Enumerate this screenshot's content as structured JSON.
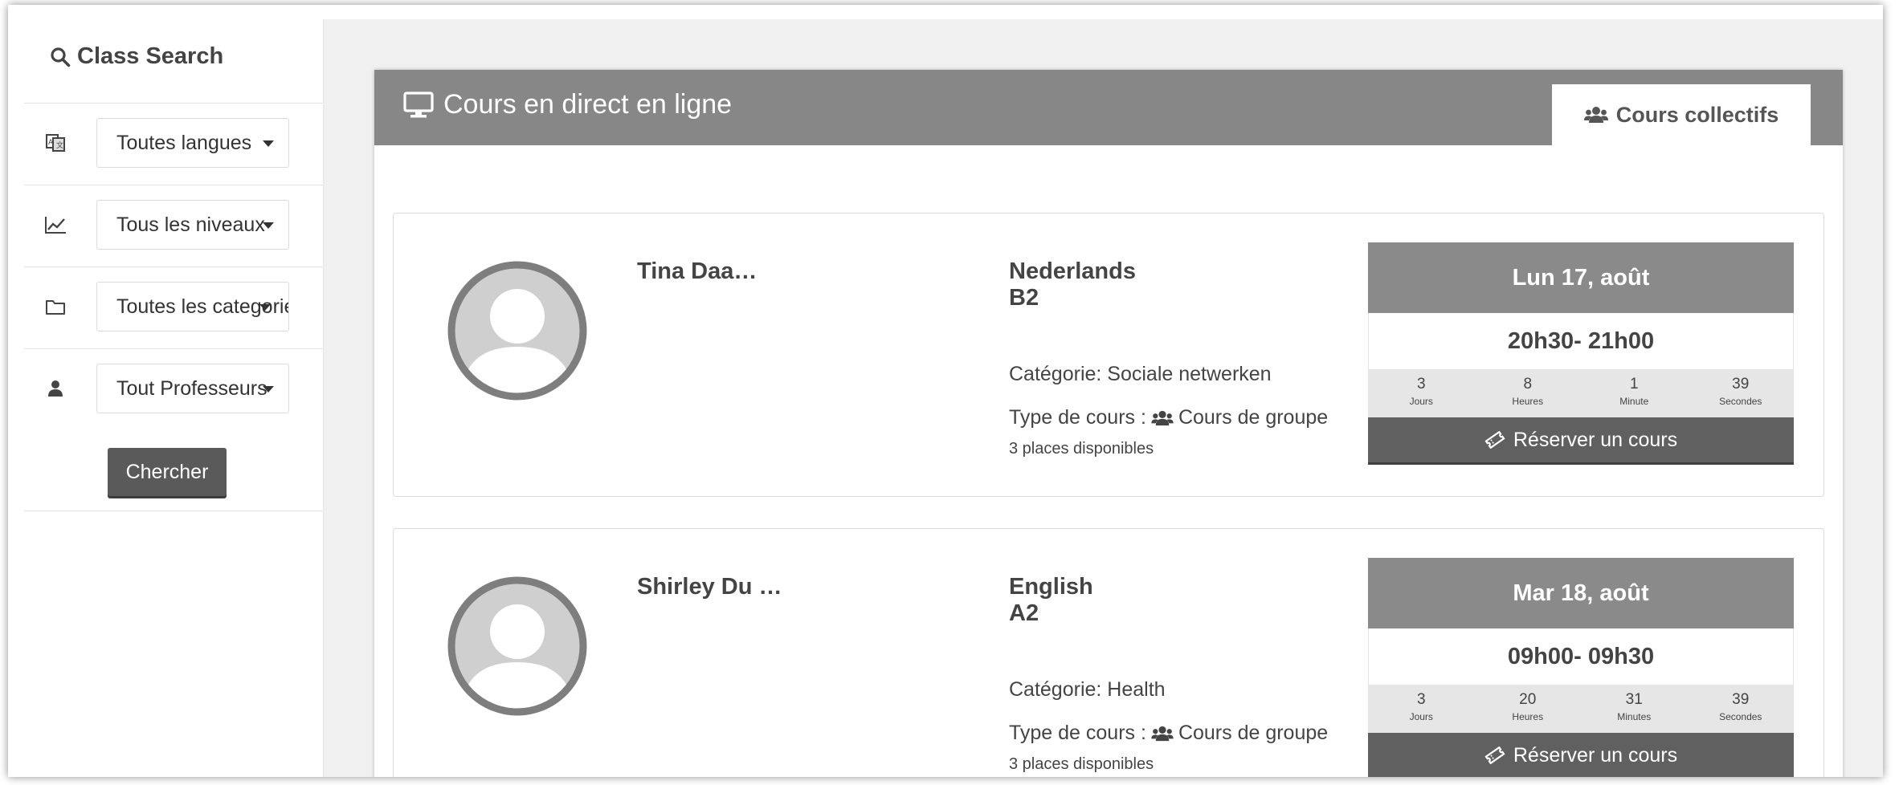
{
  "sidebar": {
    "title": "Class Search",
    "filters": [
      {
        "label": "Toutes langues",
        "icon": "translate-icon"
      },
      {
        "label": "Tous les niveaux",
        "icon": "chart-line-icon"
      },
      {
        "label": "Toutes les categorie",
        "icon": "folder-icon"
      },
      {
        "label": "Tout Professeurs",
        "icon": "user-icon"
      }
    ],
    "search_button": "Chercher"
  },
  "panel": {
    "title": "Cours en direct en ligne",
    "tab_label": "Cours collectifs"
  },
  "courses": [
    {
      "teacher": "Tina Daa…",
      "language": "Nederlands",
      "level": "B2",
      "category": "Catégorie: Sociale netwerken",
      "type_prefix": "Type de cours :",
      "type": "Cours de groupe",
      "places": "3 places disponibles",
      "date": "Lun 17, août",
      "time": "20h30- 21h00",
      "countdown": [
        {
          "value": "3",
          "unit": "Jours"
        },
        {
          "value": "8",
          "unit": "Heures"
        },
        {
          "value": "1",
          "unit": "Minute"
        },
        {
          "value": "39",
          "unit": "Secondes"
        }
      ],
      "book_label": "Réserver un cours"
    },
    {
      "teacher": "Shirley Du …",
      "language": "English",
      "level": "A2",
      "category": "Catégorie: Health",
      "type_prefix": "Type de cours :",
      "type": "Cours de groupe",
      "places": "3 places disponibles",
      "date": "Mar 18, août",
      "time": "09h00- 09h30",
      "countdown": [
        {
          "value": "3",
          "unit": "Jours"
        },
        {
          "value": "20",
          "unit": "Heures"
        },
        {
          "value": "31",
          "unit": "Minutes"
        },
        {
          "value": "39",
          "unit": "Secondes"
        }
      ],
      "book_label": "Réserver un cours"
    }
  ]
}
